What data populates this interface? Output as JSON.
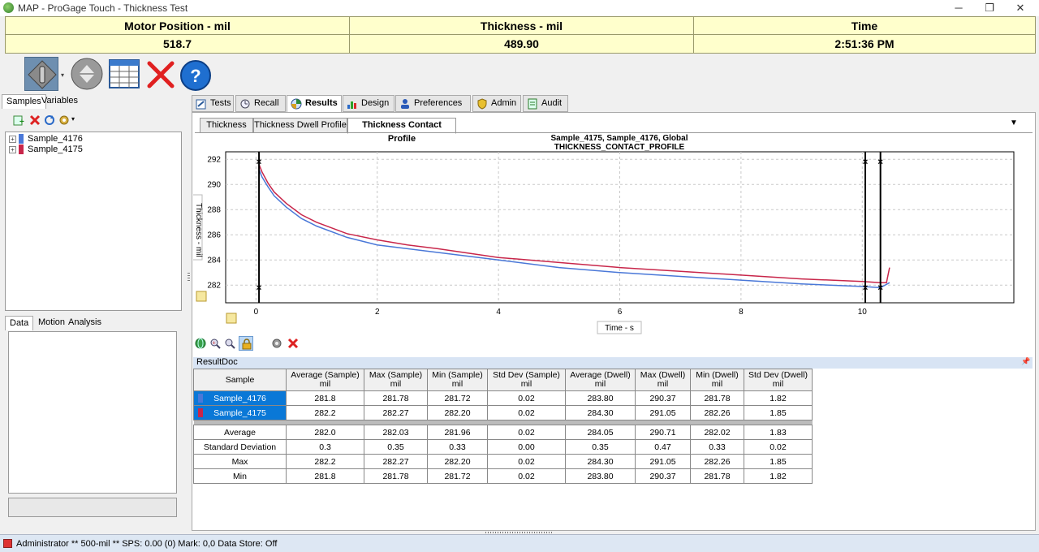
{
  "window": {
    "title": "MAP - ProGage Touch - Thickness Test",
    "controls": {
      "minimize": "─",
      "restore": "❐",
      "close": "✕"
    }
  },
  "readout": {
    "motor_label": "Motor Position - mil",
    "motor_value": "518.7",
    "thickness_label": "Thickness - mil",
    "thickness_value": "489.90",
    "time_label": "Time",
    "time_value": "2:51:36 PM"
  },
  "toolbar_icons": [
    "start-gauge-icon",
    "return-home-icon",
    "grid-table-icon",
    "cancel-x-icon",
    "help-icon"
  ],
  "left_panel": {
    "tabs": [
      "Samples",
      "Variables"
    ],
    "samples": [
      {
        "name": "Sample_4176",
        "color": "#4a78d8"
      },
      {
        "name": "Sample_4175",
        "color": "#c8264a"
      }
    ],
    "lower_tabs": [
      "Data",
      "Motion",
      "Analysis"
    ]
  },
  "main_tabs": [
    "Tests",
    "Recall",
    "Results",
    "Design",
    "Preferences",
    "Admin",
    "Audit"
  ],
  "sub_tabs": [
    "Thickness",
    "Thickness Dwell Profile",
    "Thickness Contact Profile"
  ],
  "chart_data": {
    "type": "line",
    "title": "Sample_4175, Sample_4176, Global",
    "subtitle": "THICKNESS_CONTACT_PROFILE",
    "xlabel": "Time - s",
    "ylabel": "Thickness - mil",
    "xlim": [
      -0.5,
      12.5
    ],
    "ylim": [
      280.6,
      292.6
    ],
    "xticks": [
      0,
      2,
      4,
      6,
      8,
      10
    ],
    "yticks": [
      282,
      284,
      286,
      288,
      290,
      292
    ],
    "grid": true,
    "series": [
      {
        "name": "Sample_4175",
        "color": "#c8264a",
        "x": [
          0.05,
          0.1,
          0.2,
          0.3,
          0.5,
          0.75,
          1.0,
          1.5,
          2.0,
          2.5,
          3.0,
          4.0,
          5.0,
          6.0,
          7.0,
          8.0,
          9.0,
          10.0,
          10.3,
          10.4,
          10.45
        ],
        "y": [
          291.6,
          291.0,
          290.1,
          289.4,
          288.5,
          287.6,
          287.0,
          286.1,
          285.6,
          285.2,
          284.9,
          284.2,
          283.8,
          283.4,
          283.1,
          282.8,
          282.5,
          282.3,
          282.2,
          282.2,
          283.4
        ]
      },
      {
        "name": "Sample_4176",
        "color": "#4a78d8",
        "x": [
          0.05,
          0.1,
          0.2,
          0.3,
          0.5,
          0.75,
          1.0,
          1.5,
          2.0,
          2.5,
          3.0,
          4.0,
          5.0,
          6.0,
          7.0,
          8.0,
          9.0,
          10.0,
          10.3,
          10.45
        ],
        "y": [
          291.2,
          290.6,
          289.8,
          289.1,
          288.2,
          287.3,
          286.7,
          285.8,
          285.2,
          284.9,
          284.6,
          284.0,
          283.4,
          283.0,
          282.7,
          282.4,
          282.1,
          281.9,
          281.8,
          282.2
        ]
      }
    ],
    "markers_x": [
      0.05,
      10.05,
      10.3
    ]
  },
  "chart_tools": [
    "globe-icon",
    "zoom-in-icon",
    "zoom-out-icon",
    "lock-icon",
    "gear-icon",
    "delete-icon"
  ],
  "result_doc": {
    "title": "ResultDoc",
    "pin": "📌",
    "columns": [
      "Sample",
      "Average (Sample)\nmil",
      "Max (Sample)\nmil",
      "Min (Sample)\nmil",
      "Std Dev (Sample)\nmil",
      "Average (Dwell)\nmil",
      "Max (Dwell)\nmil",
      "Min (Dwell)\nmil",
      "Std Dev (Dwell)\nmil"
    ],
    "sample_rows": [
      {
        "color": "#4a78d8",
        "cells": [
          "Sample_4176",
          "281.8",
          "281.78",
          "281.72",
          "0.02",
          "283.80",
          "290.37",
          "281.78",
          "1.82"
        ]
      },
      {
        "color": "#c8264a",
        "cells": [
          "Sample_4175",
          "282.2",
          "282.27",
          "282.20",
          "0.02",
          "284.30",
          "291.05",
          "282.26",
          "1.85"
        ]
      }
    ],
    "stat_rows": [
      [
        "Average",
        "282.0",
        "282.03",
        "281.96",
        "0.02",
        "284.05",
        "290.71",
        "282.02",
        "1.83"
      ],
      [
        "Standard Deviation",
        "0.3",
        "0.35",
        "0.33",
        "0.00",
        "0.35",
        "0.47",
        "0.33",
        "0.02"
      ],
      [
        "Max",
        "282.2",
        "282.27",
        "282.20",
        "0.02",
        "284.30",
        "291.05",
        "282.26",
        "1.85"
      ],
      [
        "Min",
        "281.8",
        "281.78",
        "281.72",
        "0.02",
        "283.80",
        "290.37",
        "281.78",
        "1.82"
      ]
    ]
  },
  "status_bar": {
    "text": "Administrator  ** 500-mil **  SPS: 0.00 (0)  Mark: 0,0  Data Store: Off"
  }
}
